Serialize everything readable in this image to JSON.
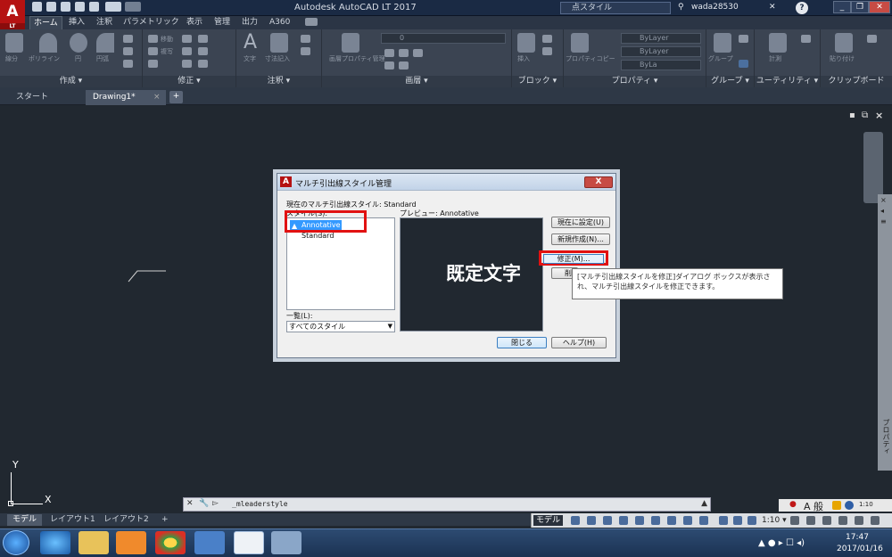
{
  "window": {
    "title": "Autodesk AutoCAD LT 2017",
    "logo_letter": "A",
    "logo_sub": "LT",
    "search_value": "点スタイル",
    "user": "wada28530",
    "help": "?"
  },
  "ribbon_tabs": [
    "ホーム",
    "挿入",
    "注釈",
    "パラメトリック",
    "表示",
    "管理",
    "出力",
    "A360"
  ],
  "ribbon_panels": [
    {
      "label": "作成 ▾",
      "tools": [
        "線分",
        "ポリライン",
        "円",
        "円弧"
      ]
    },
    {
      "label": "修正 ▾",
      "tools": [
        "移動",
        "複写"
      ]
    },
    {
      "label": "注釈 ▾",
      "tools": [
        "文字",
        "寸法記入"
      ]
    },
    {
      "label": "画層 ▾",
      "tools": [
        "画層プロパティ管理"
      ],
      "layer_value": "0"
    },
    {
      "label": "ブロック ▾",
      "tools": [
        "挿入"
      ]
    },
    {
      "label": "プロパティ ▾",
      "tools": [
        "プロパティコピー"
      ],
      "props": [
        "ByLayer",
        "ByLayer",
        "ByLa"
      ]
    },
    {
      "label": "グループ ▾",
      "tools": [
        "グループ"
      ]
    },
    {
      "label": "ユーティリティ ▾",
      "tools": [
        "計測"
      ]
    },
    {
      "label": "クリップボード",
      "tools": [
        "貼り付け"
      ]
    }
  ],
  "doc_tabs": {
    "start": "スタート",
    "drawing": "Drawing1*",
    "close": "×",
    "add": "+"
  },
  "viewport_controls": {
    "minimize": "▪",
    "restore": "⧉",
    "close": "×"
  },
  "properties_palette": {
    "label": "プロパティ",
    "close": "×",
    "pin": "◂",
    "menu": "≡"
  },
  "ucs": {
    "x": "X",
    "y": "Y"
  },
  "command": {
    "prompt": "▻",
    "text": "_mleaderstyle",
    "close": "✕",
    "wrench": "🔧",
    "up": "▲"
  },
  "annotation_tray": {
    "text": "A 般",
    "scale": "1:10"
  },
  "layout_tabs": [
    "モデル",
    "レイアウト1",
    "レイアウト2",
    "+"
  ],
  "status": {
    "model": "モデル",
    "scale": "1:10 ▾"
  },
  "taskbar": {
    "time": "17:47",
    "date": "2017/01/16"
  },
  "dialog": {
    "title": "マルチ引出線スタイル管理",
    "close": "X",
    "current_style": "現在のマルチ引出線スタイル: Standard",
    "styles_label": "スタイル(S):",
    "preview_label": "プレビュー: Annotative",
    "styles": [
      "Annotative",
      "Standard"
    ],
    "list_label": "一覧(L):",
    "list_value": "すべてのスタイル",
    "buttons": {
      "set_current": "現在に設定(U)",
      "new": "新規作成(N)...",
      "modify": "修正(M)...",
      "delete": "削除(D)",
      "close": "閉じる",
      "help": "ヘルプ(H)"
    }
  },
  "callout": "既定文字",
  "tooltip": "[マルチ引出線スタイルを修正]ダイアログ ボックスが表示され、マルチ引出線スタイルを修正できます。",
  "colors": {
    "highlight": "#e11111",
    "selection": "#3399ff",
    "canvas": "#212830"
  }
}
